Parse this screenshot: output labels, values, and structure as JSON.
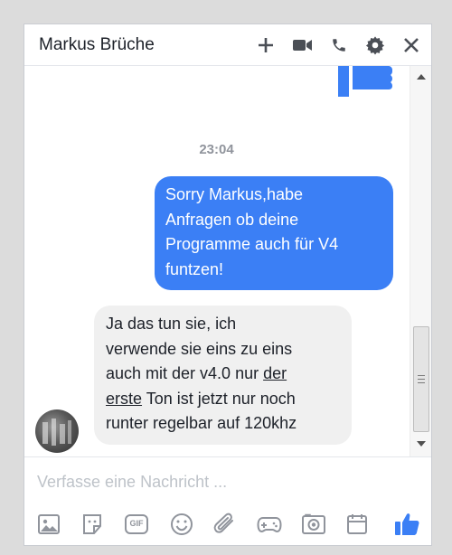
{
  "header": {
    "title": "Markus Brüche",
    "icons": [
      "plus-icon",
      "video-camera-icon",
      "phone-icon",
      "gear-icon",
      "close-icon"
    ]
  },
  "messages": [
    {
      "type": "sticker",
      "icon": "thumbs-up-icon",
      "from": "me"
    },
    {
      "type": "timestamp",
      "text": "23:04"
    },
    {
      "type": "outgoing",
      "lines": [
        "Sorry Markus,habe",
        "Anfragen ob deine",
        "Programme auch für V4",
        "funtzen!"
      ]
    },
    {
      "type": "incoming",
      "line1": "Ja das tun sie, ich",
      "line2": "verwende sie eins zu eins",
      "line3_pre": "auch mit der v4.0 nur ",
      "line3_link": "der",
      "line4_link": "erste",
      "line4_post": " Ton ist jetzt nur noch",
      "line5": "runter regelbar auf 120khz"
    }
  ],
  "composer": {
    "placeholder": "Verfasse eine Nachricht ..."
  },
  "toolbar": {
    "icons": [
      "photo-icon",
      "sticker-icon",
      "gif-icon",
      "emoji-icon",
      "attachment-icon",
      "game-icon",
      "camera-icon",
      "calendar-icon",
      "like-icon"
    ],
    "gif_label": "GIF"
  },
  "colors": {
    "accent": "#3b7ff5",
    "incoming_bubble": "#f0f0f0",
    "icon_gray": "#90949c",
    "header_icon": "#4b4f56"
  }
}
